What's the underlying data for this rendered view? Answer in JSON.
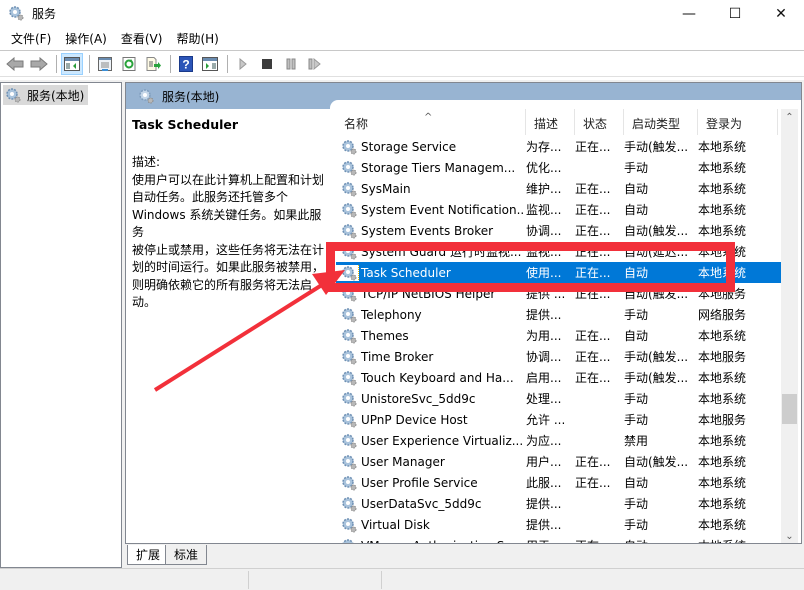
{
  "window": {
    "title": "服务",
    "controls": {
      "minimize": "—",
      "maximize": "☐",
      "close": "✕"
    }
  },
  "menu": [
    "文件(F)",
    "操作(A)",
    "查看(V)",
    "帮助(H)"
  ],
  "toolbar": {
    "buttons": [
      {
        "name": "back-button",
        "icon": "arrow-left-icon"
      },
      {
        "name": "forward-button",
        "icon": "arrow-right-icon"
      },
      {
        "name": "show-console-tree-button",
        "icon": "console-tree-icon"
      },
      {
        "name": "properties-button",
        "icon": "properties-icon"
      },
      {
        "name": "refresh-button",
        "icon": "refresh-icon"
      },
      {
        "name": "export-list-button",
        "icon": "export-icon"
      },
      {
        "name": "help-button",
        "icon": "help-icon"
      },
      {
        "name": "show-action-pane-button",
        "icon": "action-pane-icon"
      },
      {
        "name": "start-service-button",
        "icon": "play-icon"
      },
      {
        "name": "stop-service-button",
        "icon": "stop-icon"
      },
      {
        "name": "pause-service-button",
        "icon": "pause-icon"
      },
      {
        "name": "resume-service-button",
        "icon": "resume-icon"
      }
    ]
  },
  "tree": {
    "root": "服务(本地)"
  },
  "content": {
    "header": "服务(本地)",
    "selected_service": {
      "name": "Task Scheduler",
      "description_label": "描述:",
      "description": "使用户可以在此计算机上配置和计划\n自动任务。此服务还托管多个\nWindows 系统关键任务。如果此服务\n被停止或禁用，这些任务将无法在计\n划的时间运行。如果此服务被禁用，\n则明确依赖它的所有服务将无法启\n动。"
    },
    "columns": [
      "名称",
      "描述",
      "状态",
      "启动类型",
      "登录为"
    ],
    "rows": [
      {
        "name": "Storage Service",
        "desc": "为存...",
        "status": "正在...",
        "startup": "手动(触发...",
        "logon": "本地系统"
      },
      {
        "name": "Storage Tiers Managem...",
        "desc": "优化...",
        "status": "",
        "startup": "手动",
        "logon": "本地系统"
      },
      {
        "name": "SysMain",
        "desc": "维护...",
        "status": "正在...",
        "startup": "自动",
        "logon": "本地系统"
      },
      {
        "name": "System Event Notification...",
        "desc": "监视...",
        "status": "正在...",
        "startup": "自动",
        "logon": "本地系统"
      },
      {
        "name": "System Events Broker",
        "desc": "协调...",
        "status": "正在...",
        "startup": "自动(触发...",
        "logon": "本地系统"
      },
      {
        "name": "System Guard 运行时监视...",
        "desc": "监视...",
        "status": "正在...",
        "startup": "自动(延迟...",
        "logon": "本地系统"
      },
      {
        "name": "Task Scheduler",
        "desc": "使用...",
        "status": "正在...",
        "startup": "自动",
        "logon": "本地系统",
        "selected": true
      },
      {
        "name": "TCP/IP NetBIOS Helper",
        "desc": "提供 ...",
        "status": "正在...",
        "startup": "自动(触发...",
        "logon": "本地服务"
      },
      {
        "name": "Telephony",
        "desc": "提供...",
        "status": "",
        "startup": "手动",
        "logon": "网络服务"
      },
      {
        "name": "Themes",
        "desc": "为用...",
        "status": "正在...",
        "startup": "自动",
        "logon": "本地系统"
      },
      {
        "name": "Time Broker",
        "desc": "协调...",
        "status": "正在...",
        "startup": "手动(触发...",
        "logon": "本地服务"
      },
      {
        "name": "Touch Keyboard and Ha...",
        "desc": "启用...",
        "status": "正在...",
        "startup": "手动(触发...",
        "logon": "本地系统"
      },
      {
        "name": "UnistoreSvc_5dd9c",
        "desc": "处理...",
        "status": "",
        "startup": "手动",
        "logon": "本地系统"
      },
      {
        "name": "UPnP Device Host",
        "desc": "允许 ...",
        "status": "",
        "startup": "手动",
        "logon": "本地服务"
      },
      {
        "name": "User Experience Virtualiz...",
        "desc": "为应...",
        "status": "",
        "startup": "禁用",
        "logon": "本地系统"
      },
      {
        "name": "User Manager",
        "desc": "用户...",
        "status": "正在...",
        "startup": "自动(触发...",
        "logon": "本地系统"
      },
      {
        "name": "User Profile Service",
        "desc": "此服...",
        "status": "正在...",
        "startup": "自动",
        "logon": "本地系统"
      },
      {
        "name": "UserDataSvc_5dd9c",
        "desc": "提供...",
        "status": "",
        "startup": "手动",
        "logon": "本地系统"
      },
      {
        "name": "Virtual Disk",
        "desc": "提供...",
        "status": "",
        "startup": "手动",
        "logon": "本地系统"
      },
      {
        "name": "VMware Authorization Se...",
        "desc": "用于...",
        "status": "正在...",
        "startup": "自动",
        "logon": "本地系统"
      }
    ],
    "scroll_position_fraction": 0.72,
    "tabs": [
      "扩展",
      "标准"
    ],
    "active_tab": "扩展"
  },
  "colors": {
    "selection": "#0078d7",
    "header_bar": "#98b4d2",
    "annotation_red": "#f2303a"
  }
}
